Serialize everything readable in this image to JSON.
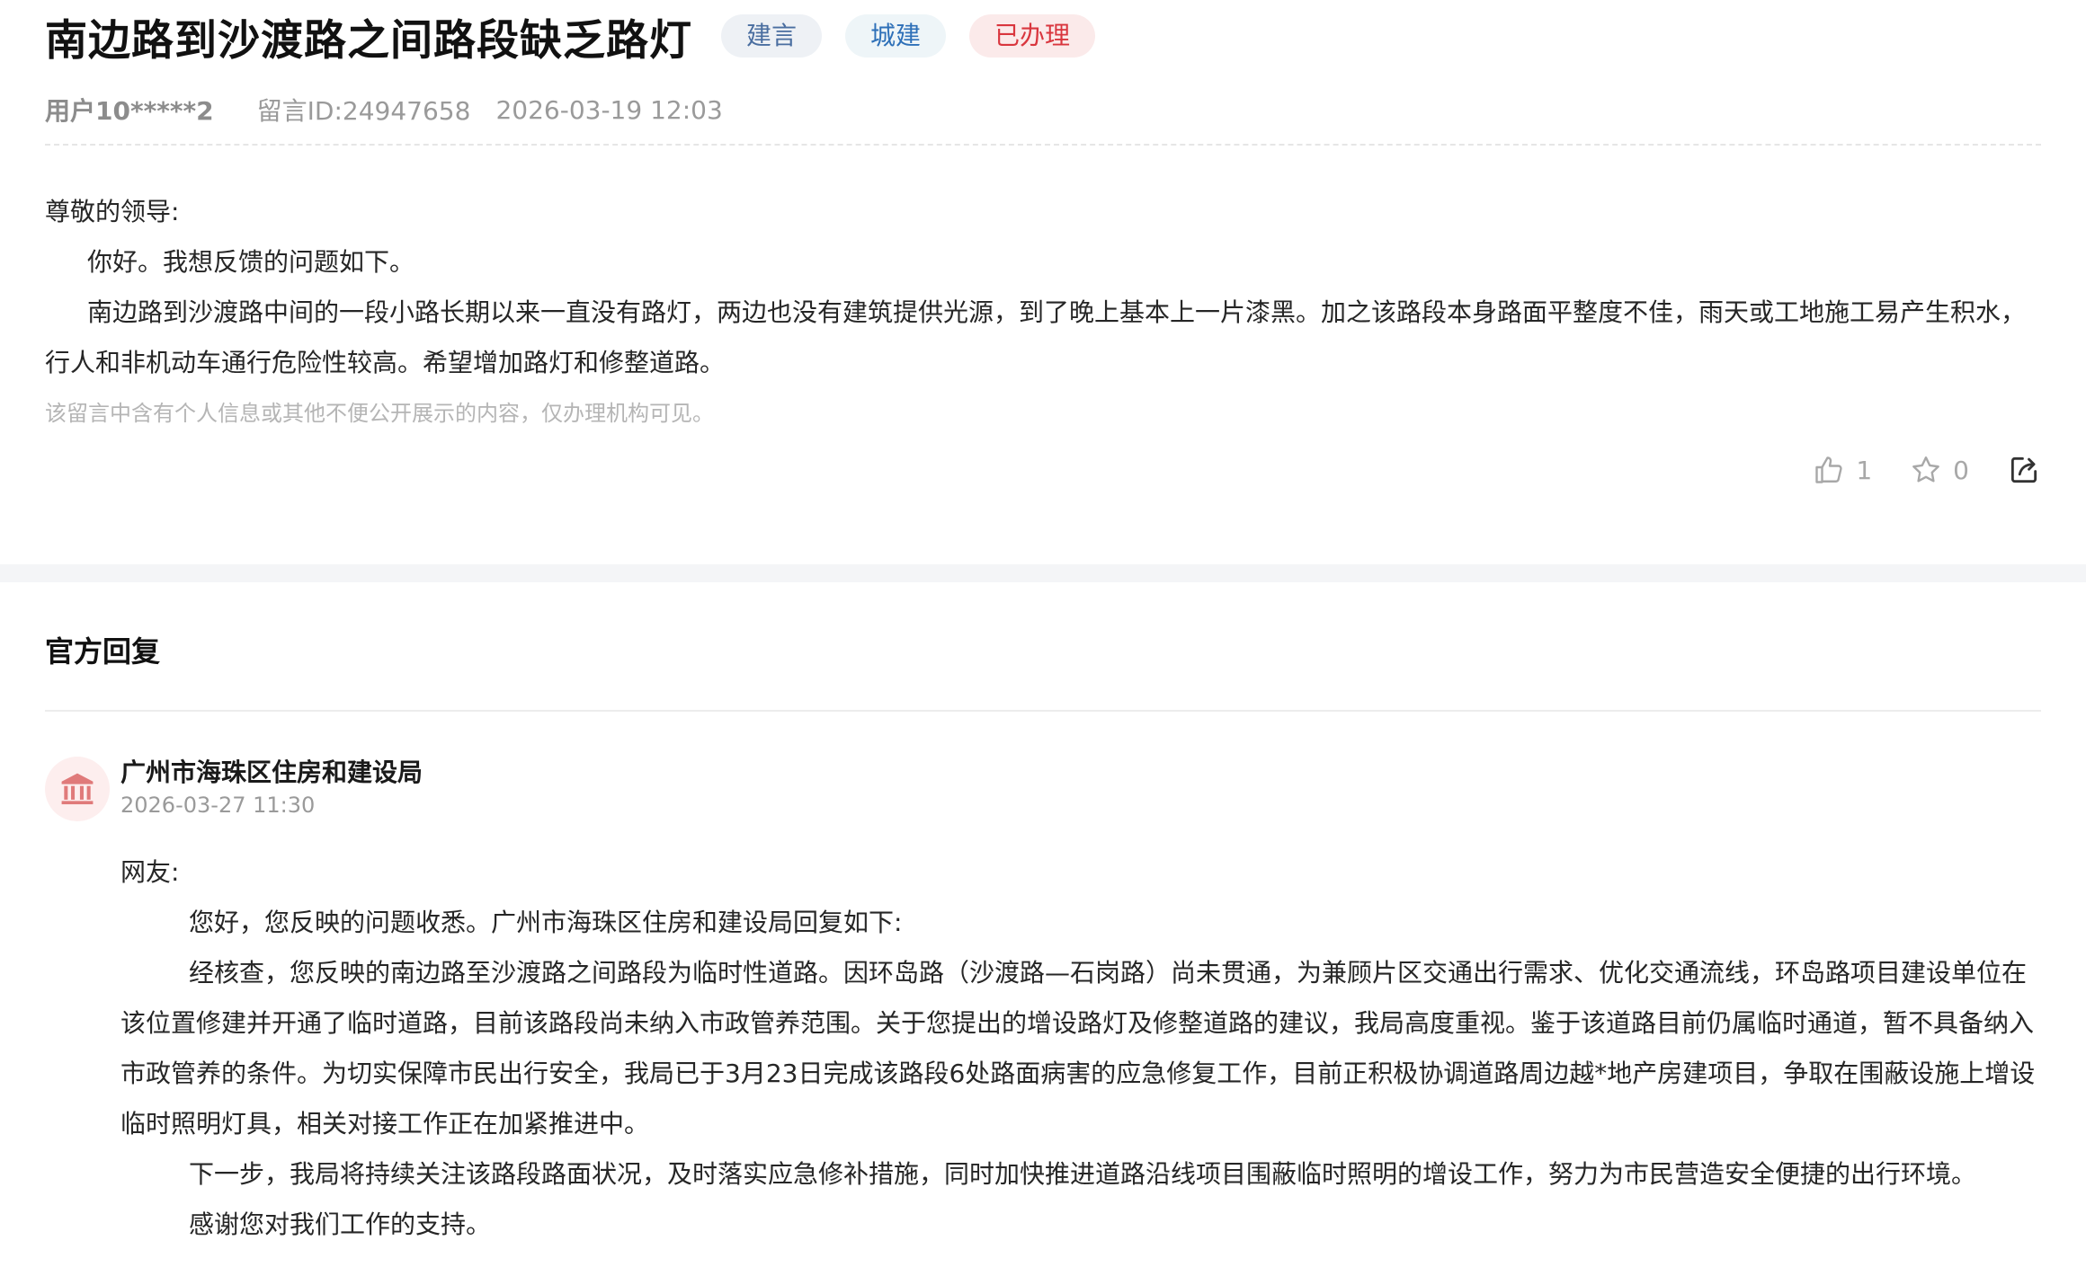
{
  "message": {
    "title": "南边路到沙渡路之间路段缺乏路灯",
    "tags": {
      "type": "建言",
      "category": "城建",
      "status": "已办理"
    },
    "meta": {
      "user": "用户10*****2",
      "message_id": "留言ID:24947658",
      "time": "2026-03-19 12:03"
    },
    "content": {
      "salutation": "尊敬的领导:",
      "p1": "你好。我想反馈的问题如下。",
      "p2": "南边路到沙渡路中间的一段小路长期以来一直没有路灯，两边也没有建筑提供光源，到了晚上基本上一片漆黑。加之该路段本身路面平整度不佳，雨天或工地施工易产生积水，行人和非机动车通行危险性较高。希望增加路灯和修整道路。"
    },
    "privacy_note": "该留言中含有个人信息或其他不便公开展示的内容，仅办理机构可见。",
    "actions": {
      "like_count": "1",
      "favorite_count": "0",
      "like_icon": "thumbs-up-icon",
      "favorite_icon": "star-icon",
      "share_icon": "share-icon"
    }
  },
  "reply": {
    "header": "官方回复",
    "org_name": "广州市海珠区住房和建设局",
    "time": "2026-03-27 11:30",
    "avatar_icon": "government-building-icon",
    "content": {
      "salutation": "网友:",
      "p1": "您好，您反映的问题收悉。广州市海珠区住房和建设局回复如下:",
      "p2": "经核查，您反映的南边路至沙渡路之间路段为临时性道路。因环岛路（沙渡路—石岗路）尚未贯通，为兼顾片区交通出行需求、优化交通流线，环岛路项目建设单位在该位置修建并开通了临时道路，目前该路段尚未纳入市政管养范围。关于您提出的增设路灯及修整道路的建议，我局高度重视。鉴于该道路目前仍属临时通道，暂不具备纳入市政管养的条件。为切实保障市民出行安全，我局已于3月23日完成该路段6处路面病害的应急修复工作，目前正积极协调道路周边越*地产房建项目，争取在围蔽设施上增设临时照明灯具，相关对接工作正在加紧推进中。",
      "p3": "下一步，我局将持续关注该路段路面状况，及时落实应急修补措施，同时加快推进道路沿线项目围蔽临时照明的增设工作，努力为市民营造安全便捷的出行环境。",
      "p4": "感谢您对我们工作的支持。"
    }
  },
  "colors": {
    "tag_type_bg": "#eef1f5",
    "tag_type_text": "#4a6ea0",
    "tag_category_bg": "#eef5f8",
    "tag_category_text": "#2e70b8",
    "tag_status_bg": "#fbeaea",
    "tag_status_text": "#d9363e",
    "avatar_bg": "#fdeeee",
    "avatar_icon": "#e07a7a",
    "section_gap": "#f4f5f7"
  }
}
